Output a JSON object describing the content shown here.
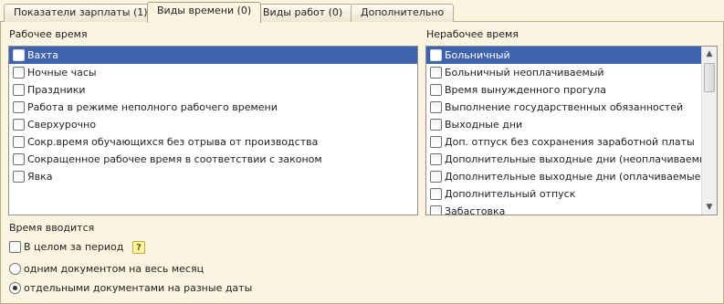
{
  "tabs": [
    {
      "label": "Показатели зарплаты (1)"
    },
    {
      "label": "Виды времени (0)"
    },
    {
      "label": "Виды работ (0)"
    },
    {
      "label": "Дополнительно"
    }
  ],
  "work_time": {
    "title": "Рабочее время",
    "items": [
      {
        "label": "Вахта",
        "checked": false,
        "selected": true
      },
      {
        "label": "Ночные часы",
        "checked": false
      },
      {
        "label": "Праздники",
        "checked": false
      },
      {
        "label": "Работа в режиме неполного рабочего времени",
        "checked": false
      },
      {
        "label": "Сверхурочно",
        "checked": false
      },
      {
        "label": "Сокр.время обучающихся без отрыва от производства",
        "checked": false
      },
      {
        "label": "Сокращенное рабочее время в соответствии с законом",
        "checked": false
      },
      {
        "label": "Явка",
        "checked": false
      }
    ]
  },
  "non_work_time": {
    "title": "Нерабочее время",
    "items": [
      {
        "label": "Больничный",
        "checked": false,
        "selected": true
      },
      {
        "label": "Больничный неоплачиваемый",
        "checked": false
      },
      {
        "label": "Время вынужденного прогула",
        "checked": false
      },
      {
        "label": "Выполнение государственных обязанностей",
        "checked": false
      },
      {
        "label": "Выходные дни",
        "checked": false
      },
      {
        "label": "Доп. отпуск без сохранения заработной платы",
        "checked": false
      },
      {
        "label": "Дополнительные выходные дни (неоплачиваемые)",
        "checked": false
      },
      {
        "label": "Дополнительные выходные дни (оплачиваемые)",
        "checked": false
      },
      {
        "label": "Дополнительный отпуск",
        "checked": false
      },
      {
        "label": "Забастовка",
        "checked": false
      }
    ]
  },
  "time_entry": {
    "title": "Время вводится",
    "total_label": "В целом за период",
    "total_checked": false,
    "help": "?",
    "options": [
      {
        "label": "одним документом на весь месяц",
        "selected": false
      },
      {
        "label": "отдельными документами на разные даты",
        "selected": true
      }
    ]
  }
}
